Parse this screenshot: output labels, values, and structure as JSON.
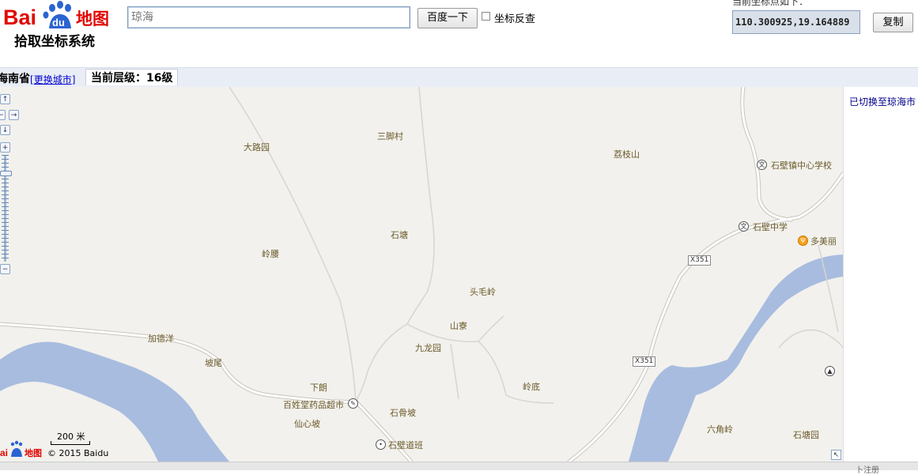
{
  "header": {
    "logo_text": "Baidu地图",
    "subtitle": "拾取坐标系统",
    "search_placeholder": "琼海",
    "search_button": "百度一下",
    "reverse_label": "坐标反查",
    "coord_caption": "当前坐标点如下：",
    "coord_value": "110.300925,19.164889",
    "copy_button": "复制"
  },
  "citybar": {
    "province": "海南省",
    "change_city": "更换城市",
    "level_label": "当前层级：16级"
  },
  "side": {
    "message": "已切换至琼海市"
  },
  "map": {
    "places": [
      "三脚村",
      "大路园",
      "荔枝山",
      "石壁镇中心学校",
      "石壁中学",
      "多美丽",
      "石塘",
      "岭腰",
      "头毛岭",
      "山寮",
      "九龙园",
      "加德洋",
      "坡尾",
      "下朗",
      "岭底",
      "百姓堂药品超市",
      "石骨坡",
      "仙心坡",
      "石壁道班",
      "六角岭",
      "石塘园"
    ],
    "roads": [
      "X351",
      "X351"
    ],
    "scale": "200 米",
    "copyright": "© 2015 Baidu",
    "mini_logo": "Baidu地图"
  },
  "zoom": {
    "in": "+",
    "out": "−"
  },
  "footer": {
    "text": "卜注册"
  },
  "colors": {
    "water": "#a8bcdf",
    "land": "#f2f1ed",
    "road": "#ffffff",
    "road_edge": "#c9c5bc",
    "brand_red": "#e10602",
    "brand_blue": "#2a64d1"
  }
}
